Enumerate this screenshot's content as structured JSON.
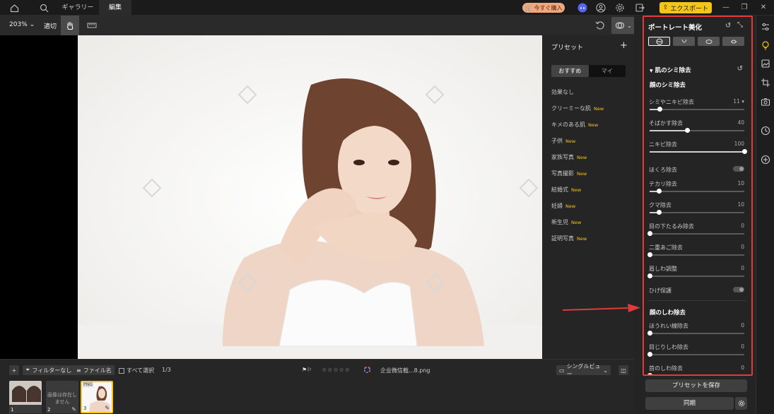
{
  "topbar": {
    "tabs": [
      {
        "label": "ギャラリー"
      },
      {
        "label": "編集"
      }
    ],
    "buy_label": "今すぐ購入",
    "export_label": "エクスポート"
  },
  "toolbar": {
    "zoom": "203%",
    "fit": "適切"
  },
  "presets": {
    "title": "プリセット",
    "tabs": [
      "おすすめ",
      "マイ"
    ],
    "badge": "New",
    "items": [
      {
        "label": "効果なし",
        "new": false
      },
      {
        "label": "クリーミーな肌",
        "new": true
      },
      {
        "label": "キメのある肌",
        "new": true
      },
      {
        "label": "子供",
        "new": true
      },
      {
        "label": "家族写真",
        "new": true
      },
      {
        "label": "写真撮影",
        "new": true
      },
      {
        "label": "結婚式",
        "new": true
      },
      {
        "label": "妊婦",
        "new": true
      },
      {
        "label": "新生児",
        "new": true
      },
      {
        "label": "証明写真",
        "new": true
      }
    ]
  },
  "bottombar": {
    "filter_label": "フィルターなし",
    "filename_label": "ファイル名",
    "select_all": "すべて選択",
    "page_count": "1/3",
    "file_name": "企业微信截...8.png",
    "view_mode": "シングルビュー",
    "thumbs": [
      {
        "num": "1"
      },
      {
        "num": "2",
        "caption": "画像は存在しません"
      },
      {
        "num": "3",
        "tag": "PNG"
      }
    ]
  },
  "portrait": {
    "title": "ポートレート美化",
    "section_title": "肌のシミ除去",
    "group1_title": "顔のシミ除去",
    "sliders1": [
      {
        "label": "シミやニキビ除去",
        "value": "11 ▾",
        "pct": 0.11
      },
      {
        "label": "そばかす除去",
        "value": "40",
        "pct": 0.4
      },
      {
        "label": "ニキビ除去",
        "value": "100",
        "pct": 1.0
      }
    ],
    "mole_label": "ほくろ除去",
    "sliders2": [
      {
        "label": "テカリ除去",
        "value": "10",
        "pct": 0.1
      },
      {
        "label": "クマ除去",
        "value": "10",
        "pct": 0.1
      },
      {
        "label": "目の下たるみ除去",
        "value": "0",
        "pct": 0.0
      },
      {
        "label": "二重あご除去",
        "value": "0",
        "pct": 0.0
      },
      {
        "label": "眉しわ調整",
        "value": "0",
        "pct": 0.0
      }
    ],
    "beard_label": "ひげ保護",
    "group2_title": "顔のしわ除去",
    "sliders3": [
      {
        "label": "ほうれい線除去",
        "value": "0",
        "pct": 0.0
      },
      {
        "label": "目じりしわ除去",
        "value": "0",
        "pct": 0.0
      },
      {
        "label": "首のしわ除去",
        "value": "0",
        "pct": 0.0
      }
    ],
    "save_preset": "プリセットを保存",
    "sync": "同期"
  },
  "colors": {
    "accent_yellow": "#f5c518",
    "highlight_red": "#e03a3a",
    "buy_orange": "#f0a87c"
  }
}
